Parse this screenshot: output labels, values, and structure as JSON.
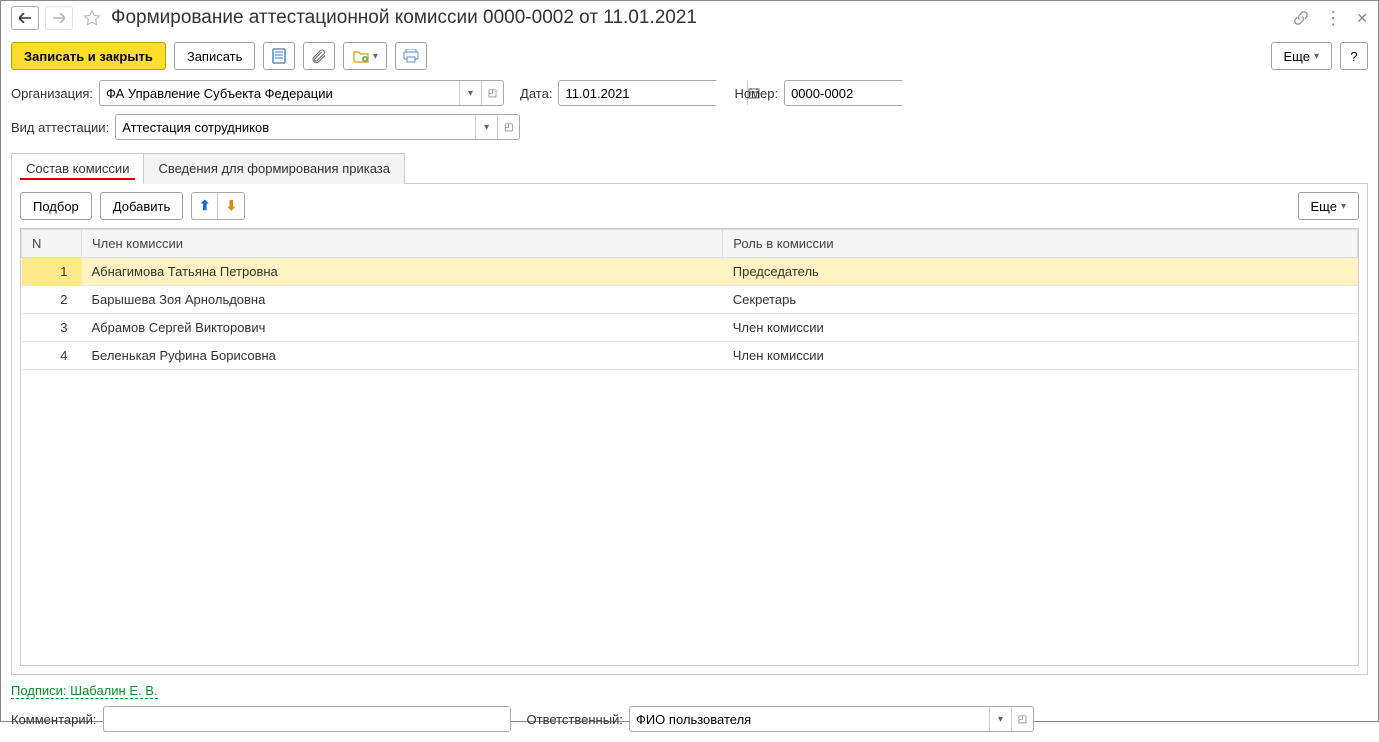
{
  "title": "Формирование аттестационной комиссии 0000-0002 от 11.01.2021",
  "toolbar": {
    "save_close": "Записать и закрыть",
    "save": "Записать",
    "more": "Еще",
    "help": "?"
  },
  "fields": {
    "org_label": "Организация:",
    "org_value": "ФА Управление Субъекта Федерации",
    "date_label": "Дата:",
    "date_value": "11.01.2021",
    "num_label": "Номер:",
    "num_value": "0000-0002",
    "att_type_label": "Вид аттестации:",
    "att_type_value": "Аттестация сотрудников",
    "comment_label": "Комментарий:",
    "comment_value": "",
    "responsible_label": "Ответственный:",
    "responsible_value": "ФИО пользователя"
  },
  "tabs": {
    "composition": "Состав комиссии",
    "order_info": "Сведения для формирования приказа"
  },
  "panel": {
    "pick": "Подбор",
    "add": "Добавить",
    "more": "Еще"
  },
  "table": {
    "headers": {
      "n": "N",
      "member": "Член комиссии",
      "role": "Роль в комиссии"
    },
    "rows": [
      {
        "n": "1",
        "member": "Абнагимова Татьяна Петровна",
        "role": "Председатель"
      },
      {
        "n": "2",
        "member": "Барышева Зоя Арнольдовна",
        "role": "Секретарь"
      },
      {
        "n": "3",
        "member": "Абрамов Сергей Викторович",
        "role": "Член комиссии"
      },
      {
        "n": "4",
        "member": "Беленькая Руфина Борисовна",
        "role": "Член комиссии"
      }
    ]
  },
  "signatures": "Подписи: Шабалин Е. В."
}
